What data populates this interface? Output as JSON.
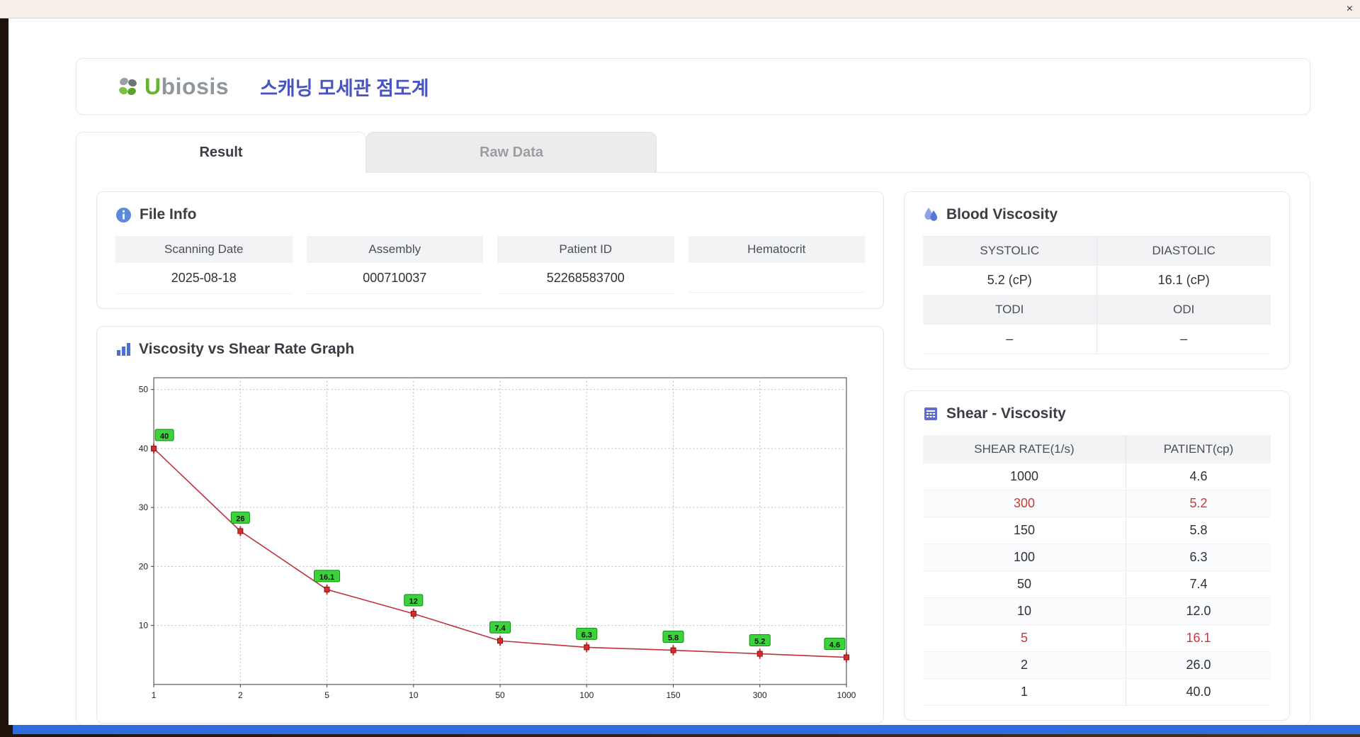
{
  "window": {
    "close_label": "×"
  },
  "header": {
    "brand_first": "U",
    "brand_rest": "biosis",
    "title": "스캐닝 모세관 점도계"
  },
  "tabs": [
    {
      "label": "Result",
      "active": true
    },
    {
      "label": "Raw Data",
      "active": false
    }
  ],
  "file_info": {
    "title": "File Info",
    "fields": [
      {
        "label": "Scanning Date",
        "value": "2025-08-18"
      },
      {
        "label": "Assembly",
        "value": "000710037"
      },
      {
        "label": "Patient ID",
        "value": "52268583700"
      },
      {
        "label": "Hematocrit",
        "value": ""
      }
    ]
  },
  "graph": {
    "title": "Viscosity vs Shear Rate Graph"
  },
  "chart_data": {
    "type": "line",
    "title": "Viscosity vs Shear Rate Graph",
    "x": [
      1,
      2,
      5,
      10,
      50,
      100,
      150,
      300,
      1000
    ],
    "x_labels": [
      "1",
      "2",
      "5",
      "10",
      "50",
      "100",
      "150",
      "300",
      "1000"
    ],
    "values": [
      40,
      26,
      16.1,
      12,
      7.4,
      6.3,
      5.8,
      5.2,
      4.6
    ],
    "point_labels": [
      "40",
      "26",
      "16.1",
      "12",
      "7.4",
      "6.3",
      "5.8",
      "5.2",
      "4.6"
    ],
    "y_ticks": [
      10,
      20,
      30,
      40,
      50
    ],
    "ylim": [
      0,
      52
    ],
    "x_scale": "categorical-log",
    "grid": true,
    "line_color": "#c2313e",
    "marker_color": "#d92b2b",
    "marker_edge": "#7e1616",
    "label_bg": "#3bd23b",
    "label_edge": "#0f8f0f"
  },
  "blood_viscosity": {
    "title": "Blood Viscosity",
    "rows": [
      {
        "headers": [
          "SYSTOLIC",
          "DIASTOLIC"
        ],
        "values": [
          "5.2 (cP)",
          "16.1 (cP)"
        ]
      },
      {
        "headers": [
          "TODI",
          "ODI"
        ],
        "values": [
          "–",
          "–"
        ]
      }
    ]
  },
  "shear_viscosity": {
    "title": "Shear - Viscosity",
    "columns": [
      "SHEAR RATE(1/s)",
      "PATIENT(cp)"
    ],
    "rows": [
      {
        "shear": "1000",
        "patient": "4.6",
        "highlight": false
      },
      {
        "shear": "300",
        "patient": "5.2",
        "highlight": true
      },
      {
        "shear": "150",
        "patient": "5.8",
        "highlight": false
      },
      {
        "shear": "100",
        "patient": "6.3",
        "highlight": false
      },
      {
        "shear": "50",
        "patient": "7.4",
        "highlight": false
      },
      {
        "shear": "10",
        "patient": "12.0",
        "highlight": false
      },
      {
        "shear": "5",
        "patient": "16.1",
        "highlight": true
      },
      {
        "shear": "2",
        "patient": "26.0",
        "highlight": false
      },
      {
        "shear": "1",
        "patient": "40.0",
        "highlight": false
      }
    ]
  },
  "colors": {
    "accent_blue": "#4853c4",
    "highlight_red": "#c43b3b",
    "header_gray": "#f2f3f5",
    "bottom_bar_blue": "#2d6bdf"
  }
}
